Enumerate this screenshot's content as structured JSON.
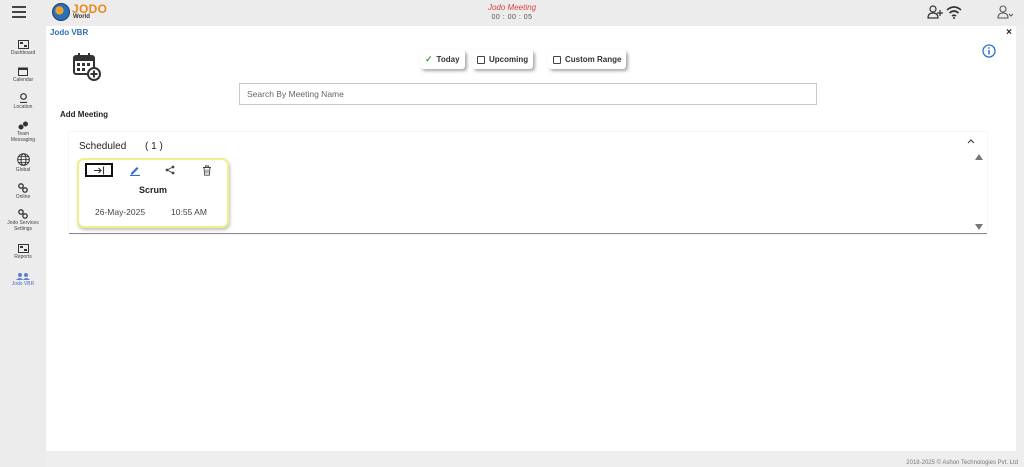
{
  "topbar": {
    "logo_brand": "JODO",
    "logo_sub": "World",
    "meeting_title": "Jodo Meeting",
    "meeting_timer": "00 : 00 : 05",
    "icons": [
      "menu-icon",
      "add-user-icon",
      "wifi-icon",
      "user-icon"
    ]
  },
  "sidebar": {
    "items": [
      {
        "label": "Dashboard",
        "icon": "dashboard-icon"
      },
      {
        "label": "Calendar",
        "icon": "calendar-icon"
      },
      {
        "label": "Location",
        "icon": "location-pin-icon"
      },
      {
        "label": "Team\nMessaging",
        "icon": "team-messaging-icon"
      },
      {
        "label": "Global",
        "icon": "globe-icon"
      },
      {
        "label": "Online",
        "icon": "online-link-icon"
      },
      {
        "label": "Jodo Services\nSettings",
        "icon": "services-settings-icon"
      },
      {
        "label": "Reports",
        "icon": "reports-icon"
      },
      {
        "label": "Jodo VBR",
        "icon": "jodo-vbr-icon"
      }
    ]
  },
  "panel": {
    "title": "Jodo VBR",
    "close_label": "×",
    "add_meeting_label": "Add Meeting",
    "filters": {
      "today": "Today",
      "upcoming": "Upcoming",
      "custom_range": "Custom Range"
    },
    "search": {
      "placeholder": "Search By Meeting Name",
      "value": ""
    }
  },
  "scheduled": {
    "heading": "Scheduled",
    "count": "( 1 )",
    "meetings": [
      {
        "name": "Scrum",
        "date": "26-May-2025",
        "time": "10:55 AM"
      }
    ]
  },
  "footer": {
    "copyright": "2018-2025 © Ashon Technologies Pvt. Ltd"
  },
  "colors": {
    "brand_orange": "#e88a1a",
    "title_blue": "#2f6fb4",
    "meeting_red": "#d9443f",
    "card_border": "#f0f08a",
    "edit_blue": "#2d6fd6"
  }
}
